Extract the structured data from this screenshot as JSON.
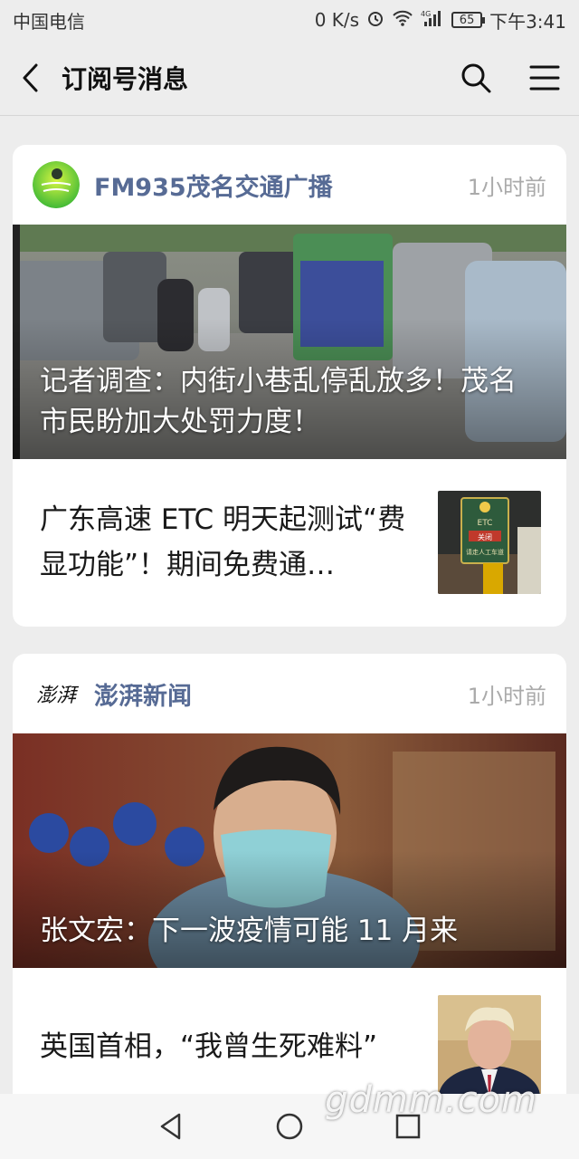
{
  "status_bar": {
    "carrier": "中国电信",
    "net_speed": "0 K/s",
    "battery": "65",
    "time": "下午3:41"
  },
  "nav": {
    "title": "订阅号消息"
  },
  "cards": [
    {
      "account": "FM935茂名交通广播",
      "time_ago": "1小时前",
      "hero_title": "记者调查：内街小巷乱停乱放多！茂名市民盼加大处罚力度！",
      "sub_title": "广东高速 ETC 明天起测试“费显功能”！期间免费通…",
      "thumb_sign_top": "ETC",
      "thumb_sign_mid": "关闭",
      "thumb_sign_bottom": "请走人工车道"
    },
    {
      "account": "澎湃新闻",
      "logo_text": "澎湃",
      "time_ago": "1小时前",
      "hero_title": "张文宏：下一波疫情可能 11 月来",
      "sub_title": "英国首相，“我曾生死难料”"
    }
  ],
  "watermark": "gdmm.com"
}
